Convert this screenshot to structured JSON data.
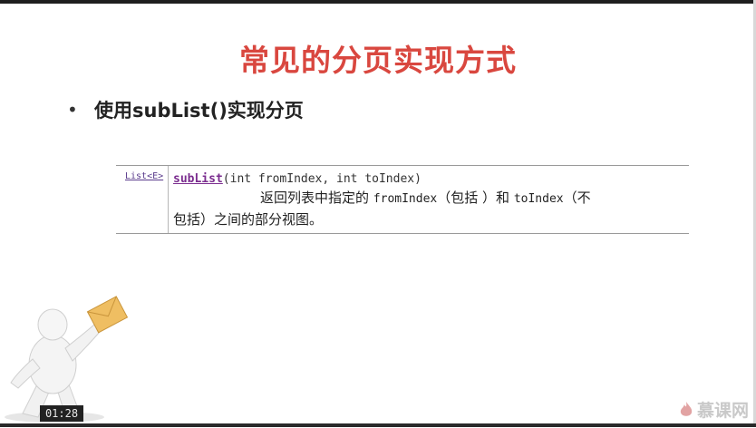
{
  "slide": {
    "title": "常见的分页实现方式",
    "bullet": "使用subList()实现分页"
  },
  "api_doc": {
    "return_type": "List<E>",
    "method_name": "subList",
    "signature_params": "(int fromIndex, int toIndex)",
    "desc_line1_a": "返回列表中指定的",
    "desc_param1": "fromIndex",
    "desc_line1_b": "（包括 ）和",
    "desc_param2": "toIndex",
    "desc_line1_c": "（不",
    "desc_line2": "包括）之间的部分视图。"
  },
  "player": {
    "timestamp": "01:28"
  },
  "logo": {
    "text": "慕课网",
    "icon": "flame-icon"
  },
  "colors": {
    "title": "#d9473f",
    "method": "#7b2d8f"
  }
}
